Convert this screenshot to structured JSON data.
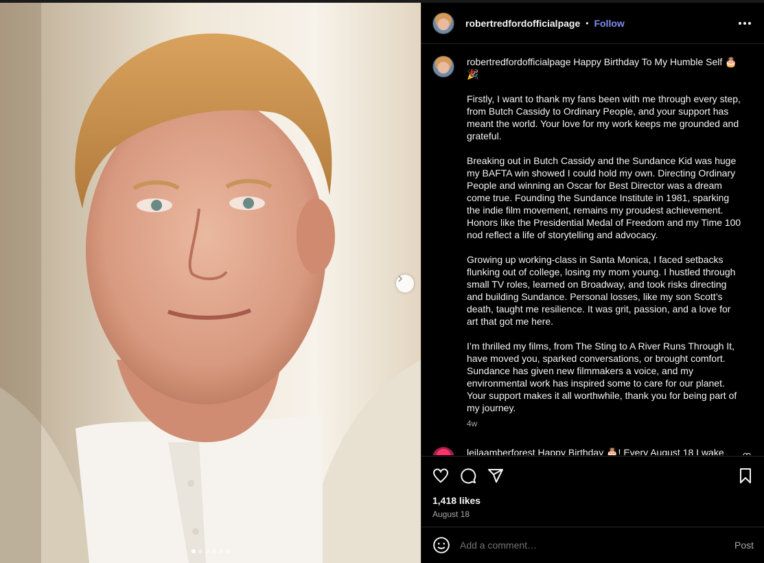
{
  "post": {
    "username": "robertredfordofficialpage",
    "separator": "•",
    "follow_label": "Follow",
    "more_icon": "more-horizontal-icon"
  },
  "caption": {
    "username": "robertredfordofficialpage",
    "headline": "Happy Birthday To My Humble Self 🎂 🎉",
    "paragraphs": [
      "Firstly, I want to thank my fans been with me through every step, from Butch Cassidy to Ordinary People, and your support has meant the world. Your love for my work keeps me grounded and grateful.",
      "Breaking out in Butch Cassidy and the Sundance Kid was huge my BAFTA win showed I could hold my own. Directing Ordinary People and winning an Oscar for Best Director was a dream come true. Founding the Sundance Institute in 1981, sparking the indie film movement, remains my proudest achievement. Honors like the Presidential Medal of Freedom and my Time 100 nod reflect a life of storytelling and advocacy.",
      "Growing up working-class in Santa Monica, I faced setbacks flunking out of college, losing my mom young. I hustled through small TV roles, learned on Broadway, and took risks directing and building Sundance. Personal losses, like my son Scott’s death, taught me resilience. It was grit, passion, and a love for art that got me here.",
      "I’m thrilled my films, from The Sting to A River Runs Through It, have moved you, sparked conversations, or brought comfort. Sundance has given new filmmakers a voice, and my environmental work has inspired some to care for our planet. Your support makes it all worthwhile, thank you for being part of my journey."
    ],
    "age": "4w"
  },
  "comment": {
    "username": "leilaamberforest",
    "text": "Happy Birthday 🎂! Every August 18 I wake"
  },
  "actions": {
    "likes": "1,418 likes",
    "date": "August 18"
  },
  "add_comment": {
    "placeholder": "Add a comment…",
    "post_label": "Post"
  },
  "carousel": {
    "slide_count": 6,
    "active_index": 0
  },
  "colors": {
    "accent": "#7f8ff4",
    "background": "#000000",
    "muted": "#a8a8a8"
  }
}
